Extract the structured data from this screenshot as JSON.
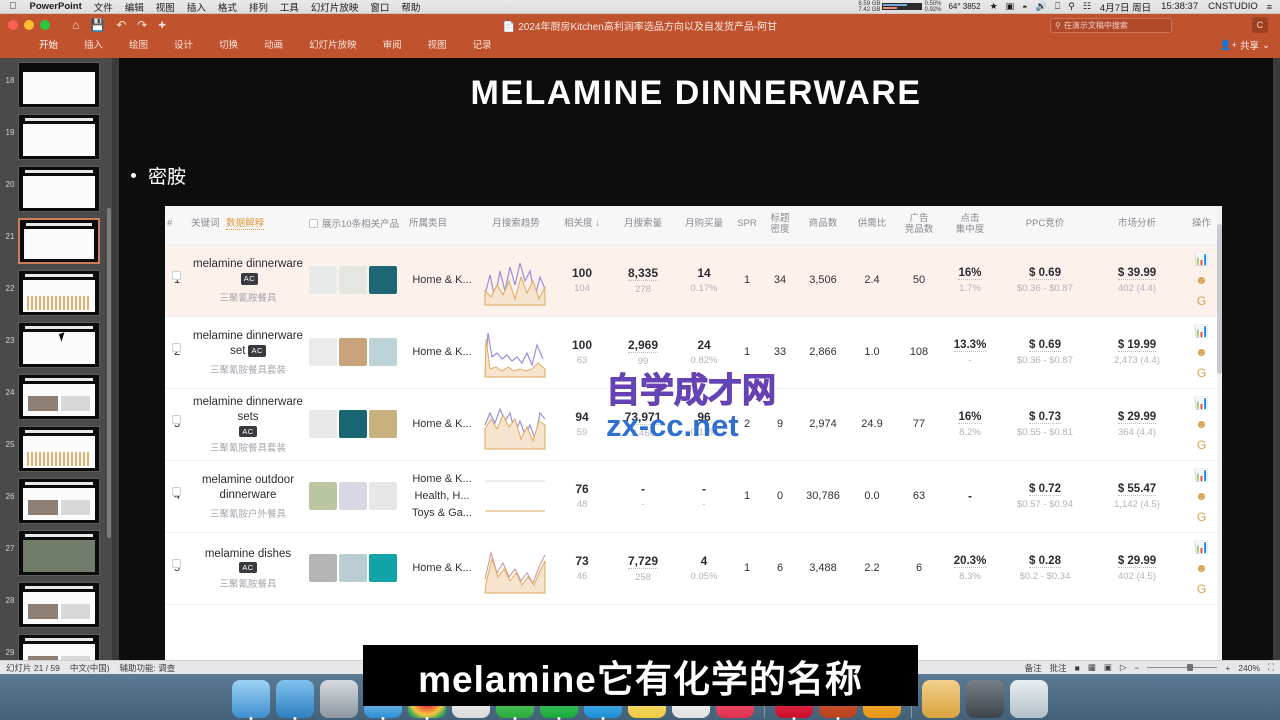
{
  "macbar": {
    "apple_icon": "apple-icon",
    "app_name": "PowerPoint",
    "menus": [
      "文件",
      "编辑",
      "视图",
      "插入",
      "格式",
      "排列",
      "工具",
      "幻灯片放映",
      "窗口",
      "帮助"
    ],
    "stats": {
      "net_down": "8.59 GB",
      "net_up": "7.42 GB",
      "cpu_label": "0.50%",
      "mem_label": "0.92%",
      "gpu_temp": "64° 3852"
    },
    "icons": [
      "bluetooth-icon",
      "display-icon",
      "wifi-icon",
      "volume-icon",
      "airplay-icon",
      "search-icon",
      "control-center-icon",
      "list-icon"
    ],
    "date": "4月7日 周日",
    "time": "15:38:37",
    "user": "CNSTUDIO"
  },
  "ppt": {
    "title": "2024年厨房Kitchen高利润率选品方向以及自发货产品-阿甘",
    "quick_access": [
      "home-icon",
      "save-icon",
      "undo-icon",
      "redo-icon",
      "add-icon"
    ],
    "search_placeholder": "在演示文稿中搜索",
    "share_label": "共享",
    "avatar_initial": "C",
    "tabs": [
      "开始",
      "插入",
      "绘图",
      "设计",
      "切换",
      "动画",
      "幻灯片放映",
      "审阅",
      "视图",
      "记录"
    ],
    "active_tab": "开始"
  },
  "thumbnails": {
    "items": [
      {
        "num": "18",
        "style": "light",
        "selected": false
      },
      {
        "num": "19",
        "style": "dark",
        "selected": false
      },
      {
        "num": "20",
        "style": "dark",
        "selected": false
      },
      {
        "num": "21",
        "style": "table",
        "selected": true
      },
      {
        "num": "22",
        "style": "chart",
        "selected": false
      },
      {
        "num": "23",
        "style": "table",
        "selected": false
      },
      {
        "num": "24",
        "style": "photo",
        "selected": false
      },
      {
        "num": "25",
        "style": "chart",
        "selected": false
      },
      {
        "num": "26",
        "style": "dark",
        "selected": false
      },
      {
        "num": "27",
        "style": "photo",
        "selected": false
      },
      {
        "num": "28",
        "style": "dark",
        "selected": false
      },
      {
        "num": "29",
        "style": "dark",
        "selected": false
      }
    ]
  },
  "slide": {
    "title": "MELAMINE DINNERWARE",
    "bullet_text": "密胺",
    "watermark_line1": "自学成才网",
    "watermark_line2": "zx-cc.net"
  },
  "table": {
    "headers": {
      "index": "#",
      "keyword": "关键词",
      "data_explain": "数据解释",
      "show_related": "展示10条相关产品",
      "category": "所属类目",
      "search_trend": "月搜索趋势",
      "relevance": "相关度 ↓",
      "search_volume": "月搜索量",
      "purchase_volume": "月购买量",
      "spr": "SPR",
      "title_density_l1": "标题",
      "title_density_l2": "密度",
      "product_count": "商品数",
      "supply_demand": "供需比",
      "ad_competitors_l1": "广告",
      "ad_competitors_l2": "竞品数",
      "click_concentration_l1": "点击",
      "click_concentration_l2": "集中度",
      "ppc_bid": "PPC竞价",
      "market_analysis": "市场分析",
      "actions": "操作"
    },
    "rows": [
      {
        "index": "1",
        "keyword_en": "melamine dinnerware",
        "badge": "AC",
        "keyword_cn": "三聚氰胺餐具",
        "categories": [
          "Home & K..."
        ],
        "relevance": "100",
        "relevance_sub": "104",
        "search_volume": "8,335",
        "search_volume_sub": "278",
        "purchase_volume": "14",
        "purchase_volume_sub": "0.17%",
        "spr": "1",
        "title_density": "34",
        "product_count": "3,506",
        "supply_demand": "2.4",
        "ad_competitors": "50",
        "click_concentration": "16%",
        "click_concentration_sub": "1.7%",
        "ppc_bid": "$ 0.69",
        "ppc_range": "$0.36 - $0.87",
        "market_price": "$ 39.99",
        "market_sub": "402 (4.4)"
      },
      {
        "index": "2",
        "keyword_en": "melamine dinnerware set",
        "badge": "AC",
        "keyword_cn": "三聚氰胺餐具套装",
        "categories": [
          "Home & K..."
        ],
        "relevance": "100",
        "relevance_sub": "63",
        "search_volume": "2,969",
        "search_volume_sub": "99",
        "purchase_volume": "24",
        "purchase_volume_sub": "0.82%",
        "spr": "1",
        "title_density": "33",
        "product_count": "2,866",
        "supply_demand": "1.0",
        "ad_competitors": "108",
        "click_concentration": "13.3%",
        "click_concentration_sub": "-",
        "ppc_bid": "$ 0.69",
        "ppc_range": "$0.36 - $0.87",
        "market_price": "$ 19.99",
        "market_sub": "2,473 (4.4)"
      },
      {
        "index": "3",
        "keyword_en": "melamine dinnerware sets",
        "badge": "AC",
        "keyword_cn": "三聚氰胺餐具套装",
        "categories": [
          "Home & K..."
        ],
        "relevance": "94",
        "relevance_sub": "59",
        "search_volume": "73,971",
        "search_volume_sub": "2,466",
        "purchase_volume": "96",
        "purchase_volume_sub": "0.13%",
        "spr": "2",
        "title_density": "9",
        "product_count": "2,974",
        "supply_demand": "24.9",
        "ad_competitors": "77",
        "click_concentration": "16%",
        "click_concentration_sub": "8.2%",
        "ppc_bid": "$ 0.73",
        "ppc_range": "$0.55 - $0.81",
        "market_price": "$ 29.99",
        "market_sub": "364 (4.4)"
      },
      {
        "index": "4",
        "keyword_en": "melamine outdoor dinnerware",
        "badge": "",
        "keyword_cn": "三聚氰胺户外餐具",
        "categories": [
          "Home & K...",
          "Health, H...",
          "Toys & Ga..."
        ],
        "relevance": "76",
        "relevance_sub": "48",
        "search_volume": "-",
        "search_volume_sub": "-",
        "purchase_volume": "-",
        "purchase_volume_sub": "-",
        "spr": "1",
        "title_density": "0",
        "product_count": "30,786",
        "supply_demand": "0.0",
        "ad_competitors": "63",
        "click_concentration": "-",
        "click_concentration_sub": "",
        "ppc_bid": "$ 0.72",
        "ppc_range": "$0.57 - $0.94",
        "market_price": "$ 55.47",
        "market_sub": "1,142 (4.5)"
      },
      {
        "index": "5",
        "keyword_en": "melamine dishes",
        "badge": "AC",
        "keyword_cn": "三聚氰胺餐具",
        "categories": [
          "Home & K..."
        ],
        "relevance": "73",
        "relevance_sub": "46",
        "search_volume": "7,729",
        "search_volume_sub": "258",
        "purchase_volume": "4",
        "purchase_volume_sub": "0.05%",
        "spr": "1",
        "title_density": "6",
        "product_count": "3,488",
        "supply_demand": "2.2",
        "ad_competitors": "6",
        "click_concentration": "20.3%",
        "click_concentration_sub": "8.3%",
        "ppc_bid": "$ 0.28",
        "ppc_range": "$0.2 - $0.34",
        "market_price": "$ 29.99",
        "market_sub": "402 (4.5)"
      }
    ],
    "action_icons": [
      "bar-chart-icon",
      "smiley-icon",
      "google-icon"
    ]
  },
  "subtitle": {
    "text": "melamine它有化学的名称"
  },
  "statusbar": {
    "slide_counter": "幻灯片 21 / 59",
    "language": "中文(中国)",
    "accessibility": "辅助功能: 调查",
    "notes_label": "备注",
    "comments_label": "批注",
    "zoom_level": "240%",
    "view_icons": [
      "normal-view-icon",
      "sorter-view-icon",
      "reading-view-icon",
      "slideshow-icon"
    ]
  },
  "dock": {
    "items": [
      {
        "name": "finder-icon",
        "color": "#4aa3e8",
        "running": true
      },
      {
        "name": "mail-icon",
        "color": "#3f9fe0",
        "running": true
      },
      {
        "name": "launchpad-icon",
        "color": "#9aa3ad",
        "running": false
      },
      {
        "name": "safari-icon",
        "color": "#2d8fd6",
        "running": true
      },
      {
        "name": "chrome-icon",
        "color": "#eceff1",
        "running": true
      },
      {
        "name": "photos-icon",
        "color": "#f2f2f2",
        "running": false
      },
      {
        "name": "messages-icon",
        "color": "#49cb5c",
        "running": true
      },
      {
        "name": "wechat-icon",
        "color": "#2bb540",
        "running": true
      },
      {
        "name": "qq-icon",
        "color": "#27a3ef",
        "running": true
      },
      {
        "name": "notes-icon",
        "color": "#fbe26b",
        "running": false
      },
      {
        "name": "calendar-icon",
        "color": "#f7f7f7",
        "running": false
      },
      {
        "name": "music-icon",
        "color": "#f4516c",
        "running": false
      },
      {
        "name": "opera-icon",
        "color": "#e8304a",
        "running": true
      },
      {
        "name": "powerpoint-icon",
        "color": "#c0522e",
        "running": true
      },
      {
        "name": "keynote-icon",
        "color": "#f0a51e",
        "running": false
      },
      {
        "name": "folder-icon",
        "color": "#e0b259",
        "running": false
      },
      {
        "name": "preferences-icon",
        "color": "#5a5f66",
        "running": false
      },
      {
        "name": "trash-icon",
        "color": "#c9d3d8",
        "running": false
      }
    ]
  }
}
